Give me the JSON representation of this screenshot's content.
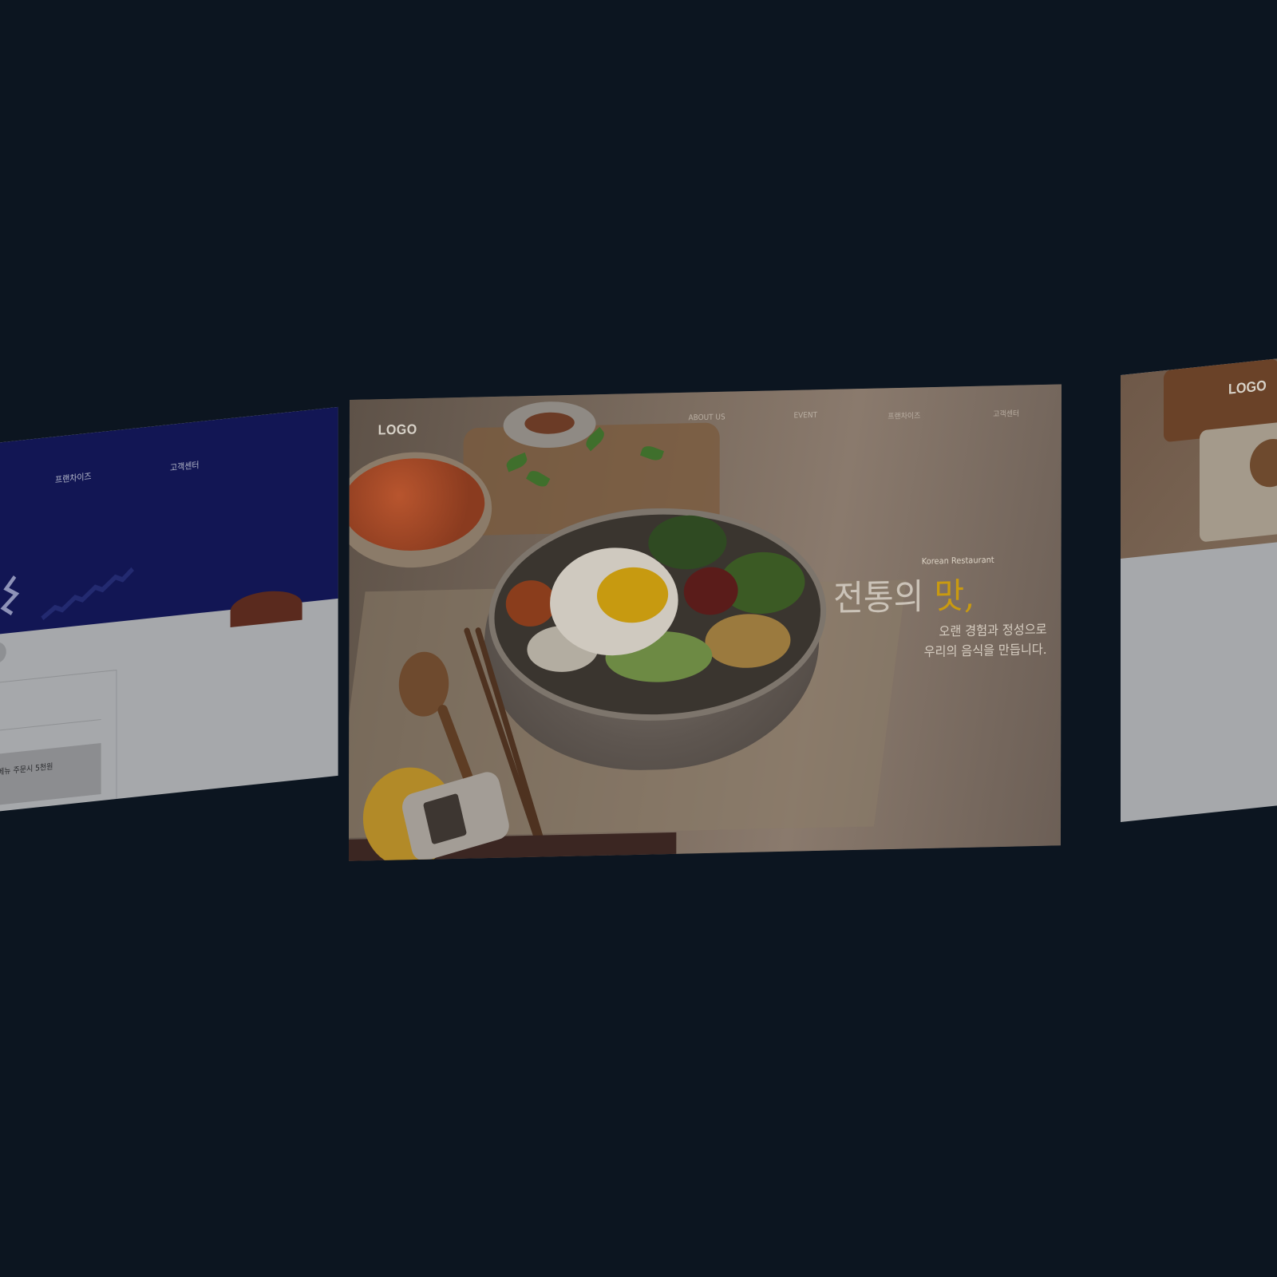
{
  "left_page": {
    "nav": [
      "프랜차이즈",
      "고객센터"
    ],
    "promo_text": "메뉴 주문시 5천원"
  },
  "center_page": {
    "logo": "LOGO",
    "nav": [
      "ABOUT US",
      "EVENT",
      "프랜차이즈",
      "고객센터"
    ],
    "tagline": "Korean Restaurant",
    "title_main": "전통의 ",
    "title_accent": "맛,",
    "subtitle_line1": "오랜 경험과 정성으로",
    "subtitle_line2": "우리의 음식을 만듭니다."
  },
  "right_page": {
    "logo": "LOGO"
  },
  "colors": {
    "background": "#0c1520",
    "left_banner": "#121654",
    "accent_gold": "#c99a10"
  }
}
